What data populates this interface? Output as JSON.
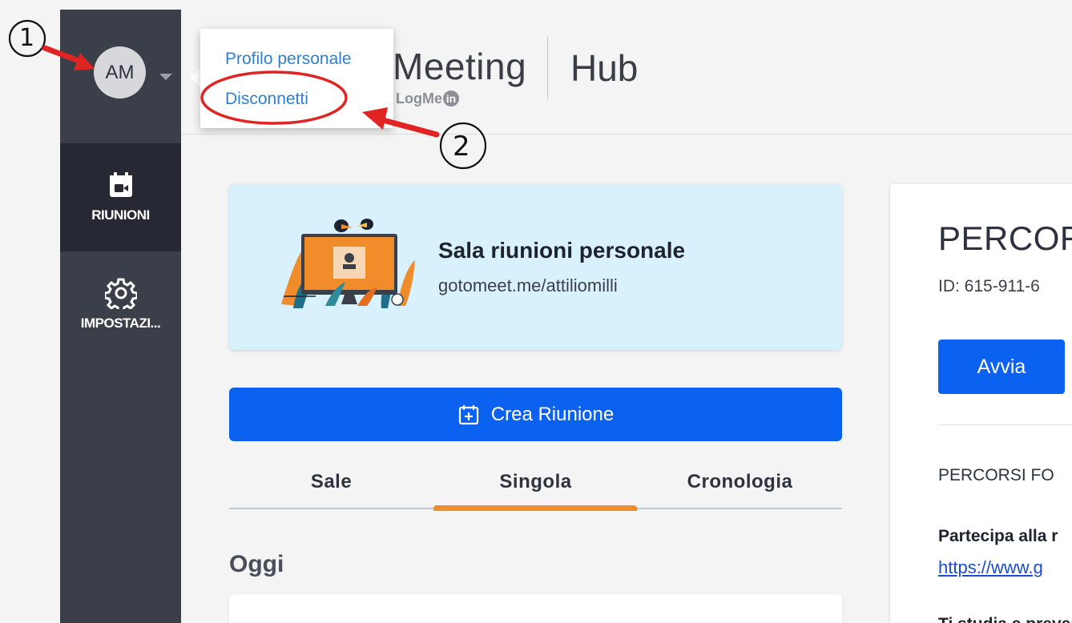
{
  "user": {
    "initials": "AM"
  },
  "menu": {
    "items": [
      {
        "label": "Profilo personale"
      },
      {
        "label": "Disconnetti"
      }
    ]
  },
  "brand": {
    "product": "Meeting",
    "logmein": "LogMe",
    "in": "in",
    "hub": "Hub"
  },
  "sidebar": {
    "items": [
      {
        "label": "RIUNIONI",
        "icon": "calendar-video-icon",
        "active": true
      },
      {
        "label": "IMPOSTAZI...",
        "icon": "gear-icon",
        "active": false
      }
    ]
  },
  "personal_room": {
    "title": "Sala riunioni personale",
    "url": "gotomeet.me/attiliomilli"
  },
  "create_button": {
    "label": "Crea Riunione",
    "icon": "calendar-plus-icon"
  },
  "tabs": [
    {
      "label": "Sale"
    },
    {
      "label": "Singola",
      "active": true
    },
    {
      "label": "Cronologia"
    }
  ],
  "today": {
    "heading": "Oggi"
  },
  "meeting_card": {
    "title": "PERCOR",
    "id": "ID: 615-911-6",
    "start_label": "Avvia",
    "name_label": "PERCORSI FO",
    "join_label": "Partecipa alla r",
    "link": "https://www.g",
    "more": "Ti studia e prevent"
  },
  "annotations": {
    "step1": "1",
    "step2": "2"
  },
  "colors": {
    "accent": "#0b62f0",
    "sidebar": "#3b3f4a",
    "tab_indicator": "#f08c2a",
    "annotation_red": "#e02424"
  }
}
